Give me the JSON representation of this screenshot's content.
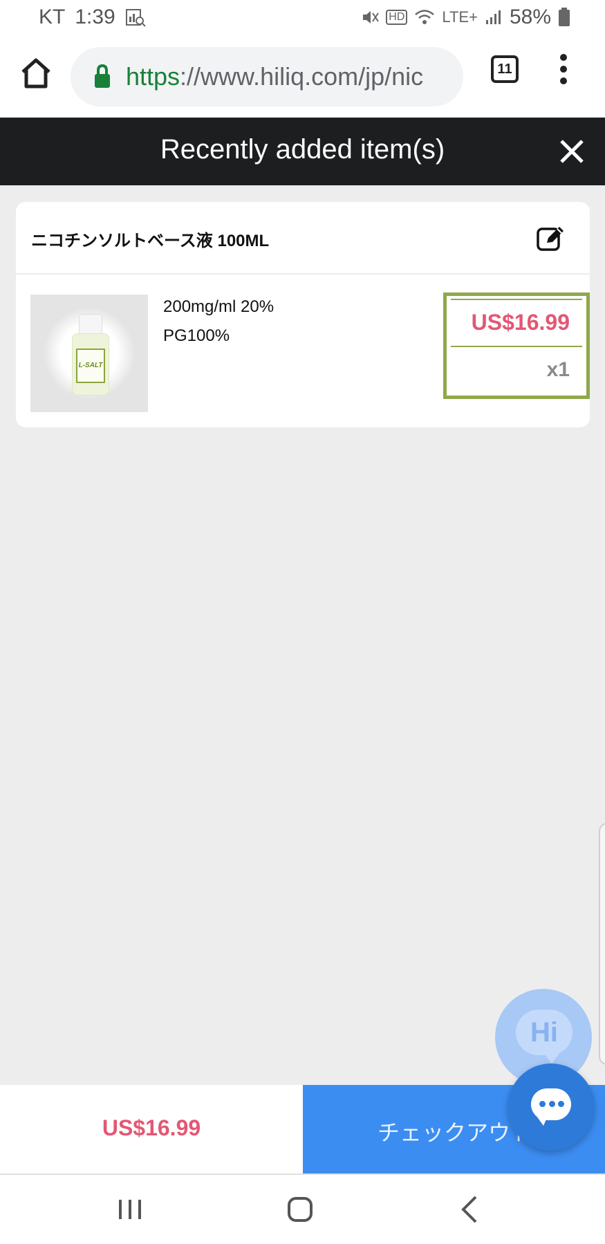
{
  "status_bar": {
    "carrier": "KT",
    "time": "1:39",
    "network": "LTE+",
    "hd": "HD",
    "battery": "58%"
  },
  "browser": {
    "url_scheme": "https",
    "url_rest": "://www.hiliq.com/jp/nic",
    "tab_count": "11"
  },
  "cart": {
    "title": "Recently added item(s)"
  },
  "item": {
    "name": "ニコチンソルトベース液 100ML",
    "thumb_label": "L-SALT",
    "variant_line1": "200mg/ml 20%",
    "variant_line2": "PG100%",
    "price": "US$16.99",
    "quantity": "x1"
  },
  "chat": {
    "hi_label": "Hi"
  },
  "footer": {
    "total": "US$16.99",
    "checkout_label": "チェックアウト"
  },
  "colors": {
    "price": "#e35774",
    "checkout_bg": "#3c8df2",
    "header_bg": "#1d1e20",
    "highlight_border": "#8fa84a"
  }
}
